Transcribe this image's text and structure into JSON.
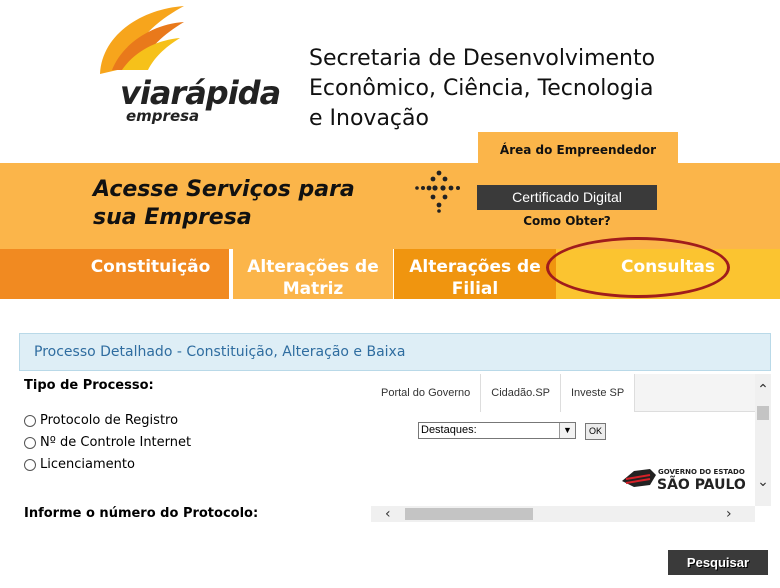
{
  "header": {
    "logo_text": "viarápida",
    "logo_sub": "empresa",
    "secretaria": [
      "Secretaria de Desenvolvimento",
      "Econômico, Ciência, Tecnologia",
      "e Inovação"
    ],
    "area_tab": "Área do Empreendedor"
  },
  "banner": {
    "acesse": [
      "Acesse Serviços para",
      "sua Empresa"
    ],
    "cert_button": "Certificado Digital",
    "como_obter": "Como Obter?"
  },
  "nav": {
    "items": [
      {
        "label": [
          "Constituição"
        ]
      },
      {
        "label": [
          "Alterações de",
          "Matriz"
        ]
      },
      {
        "label": [
          "Alterações de",
          "Filial"
        ]
      },
      {
        "label": [
          "Consultas"
        ]
      }
    ],
    "highlight_color": "#a01c1c"
  },
  "section": {
    "title": "Processo Detalhado - Constituição, Alteração e Baixa"
  },
  "form": {
    "tipo_label": "Tipo de Processo:",
    "options": [
      "Protocolo de Registro",
      "Nº de Controle Internet",
      "Licenciamento"
    ],
    "informe_label": "Informe o número do Protocolo:",
    "submit": "Pesquisar"
  },
  "frame": {
    "tabs": [
      "Portal do Governo",
      "Cidadão.SP",
      "Investe SP"
    ],
    "select_value": "Destaques:",
    "ok": "OK",
    "gov_line1": "GOVERNO DO ESTADO",
    "gov_line2": "SÃO PAULO"
  },
  "colors": {
    "orange_light": "#fbb54a",
    "orange_dark": "#f18a21",
    "blue_text": "#2f6da0"
  }
}
